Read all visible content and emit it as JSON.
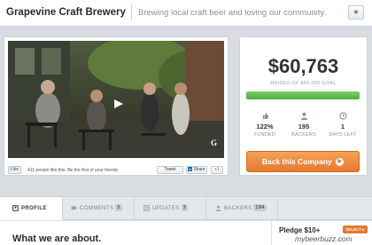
{
  "header": {
    "company_name": "Grapevine Craft Brewery",
    "tagline": "Brewing local craft beer and loving our community.",
    "star_icon": "star-icon"
  },
  "video": {
    "play_icon": "play-icon",
    "corner_logo": "G"
  },
  "social": {
    "like_label": "Like",
    "like_text": "411 people like this. Be the first of your friends.",
    "tweet_label": "Tweet",
    "share_label": "Share",
    "plus_label": "+1"
  },
  "funding": {
    "amount": "$60,763",
    "goal_text": "RAISED OF $50,000 GOAL",
    "progress_percent": 100,
    "stats": [
      {
        "icon": "thumbs-up-icon",
        "value": "122%",
        "label": "FUNDED"
      },
      {
        "icon": "person-icon",
        "value": "195",
        "label": "BACKERS"
      },
      {
        "icon": "clock-icon",
        "value": "1",
        "label": "DAYS LEFT"
      }
    ],
    "back_button_label": "Back this Company"
  },
  "tabs": [
    {
      "icon": "profile-icon",
      "label": "PROFILE",
      "count": ""
    },
    {
      "icon": "comments-icon",
      "label": "COMMENTS",
      "count": "2"
    },
    {
      "icon": "updates-icon",
      "label": "UPDATES",
      "count": "3"
    },
    {
      "icon": "backers-icon",
      "label": "BACKERS",
      "count": "194"
    }
  ],
  "main": {
    "about_title": "What we are about."
  },
  "pledge": {
    "title": "Pledge $10+",
    "select_label": "SELECT"
  },
  "watermark": "mybeerbuzz.com",
  "colors": {
    "accent_orange": "#e5792d",
    "progress_green": "#4fae3f",
    "page_bg": "#d9dde1"
  }
}
